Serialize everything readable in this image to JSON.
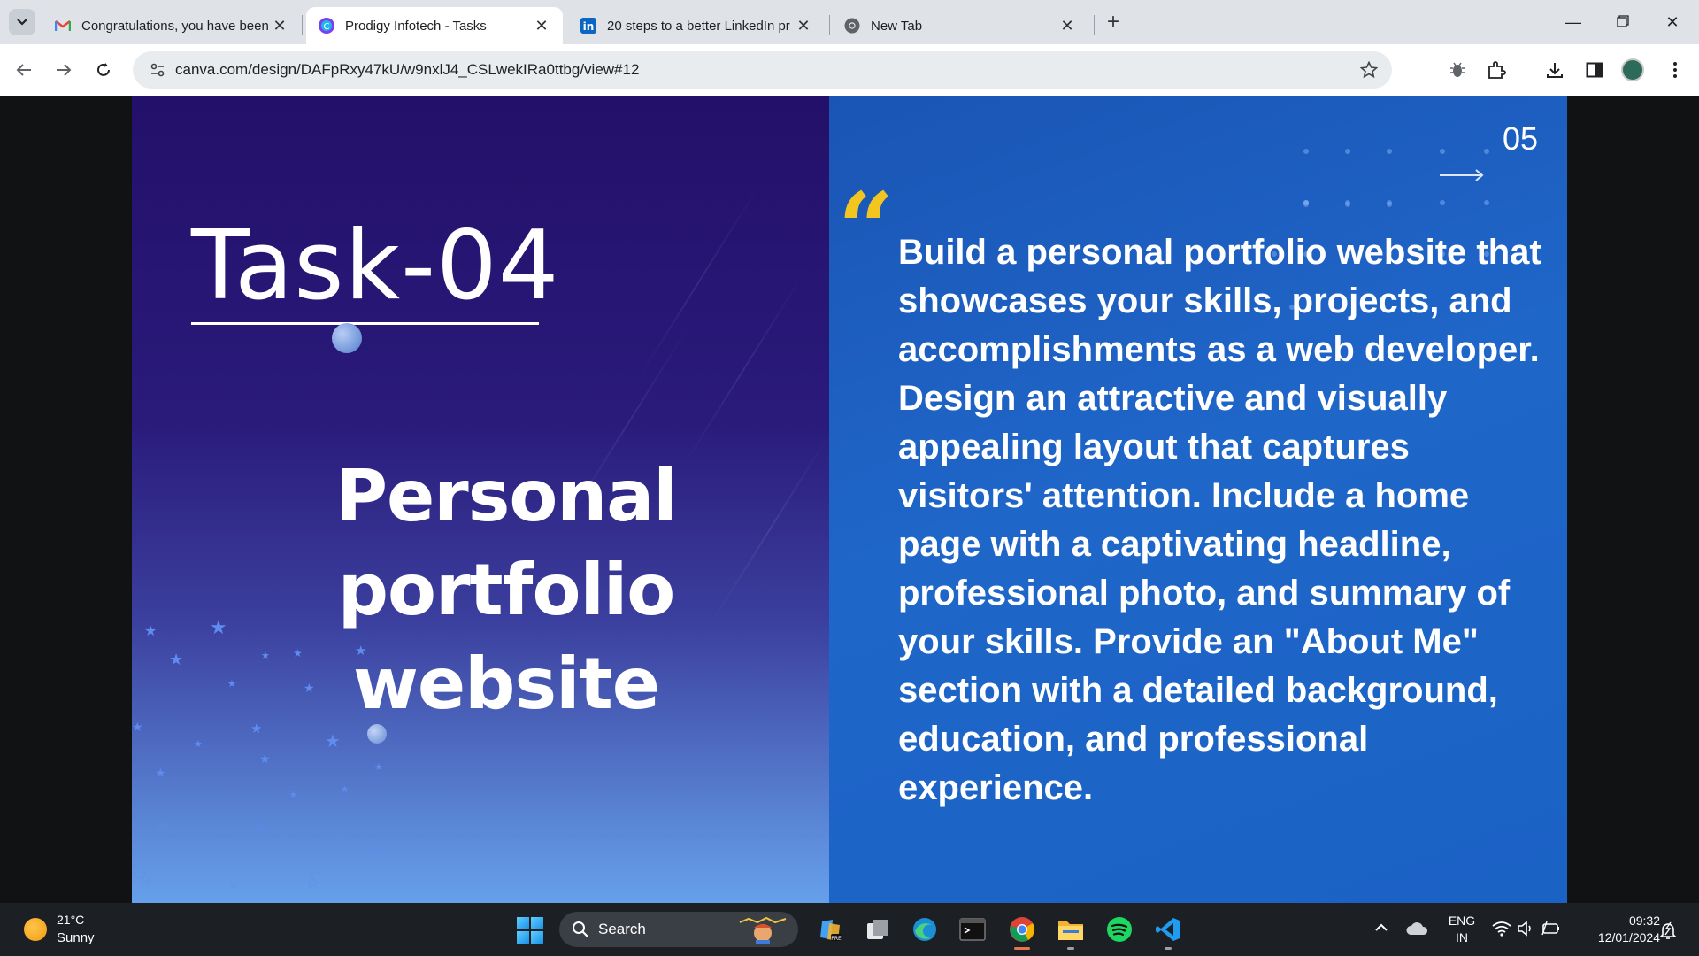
{
  "browser": {
    "tabs": [
      {
        "title": "Congratulations, you have been",
        "icon": "gmail-icon"
      },
      {
        "title": "Prodigy Infotech - Tasks",
        "icon": "canva-icon",
        "active": true
      },
      {
        "title": "20 steps to a better LinkedIn pr",
        "icon": "linkedin-icon"
      },
      {
        "title": "New Tab",
        "icon": "chrome-icon"
      }
    ],
    "new_tab_label": "+",
    "url": "canva.com/design/DAFpRxy47kU/w9nxlJ4_CSLwekIRa0ttbg/view#12"
  },
  "slide": {
    "task_title": "Task-04",
    "project_title_line1": "Personal portfolio",
    "project_title_line2": "website",
    "slide_number": "05",
    "quote_mark": "“",
    "description": "Build a personal portfolio website that showcases your skills, projects, and accomplishments as a web developer. Design an attractive and visually appealing layout that captures visitors' attention. Include a home page with a captivating headline, professional photo, and summary of your skills. Provide an \"About Me\" section with a detailed background, education, and professional experience.",
    "colors": {
      "left_bg": "#23106a",
      "right_bg": "#1f66c9",
      "quote_accent": "#f2c521",
      "text": "#ffffff"
    }
  },
  "taskbar": {
    "weather_temp": "21°C",
    "weather_condition": "Sunny",
    "search_label": "Search",
    "apps": [
      "store-icon",
      "task-view-icon",
      "edge-icon",
      "terminal-icon",
      "chrome-icon",
      "file-explorer-icon",
      "spotify-icon",
      "vscode-icon"
    ],
    "language_line1": "ENG",
    "language_line2": "IN",
    "time": "09:32",
    "date": "12/01/2024"
  }
}
